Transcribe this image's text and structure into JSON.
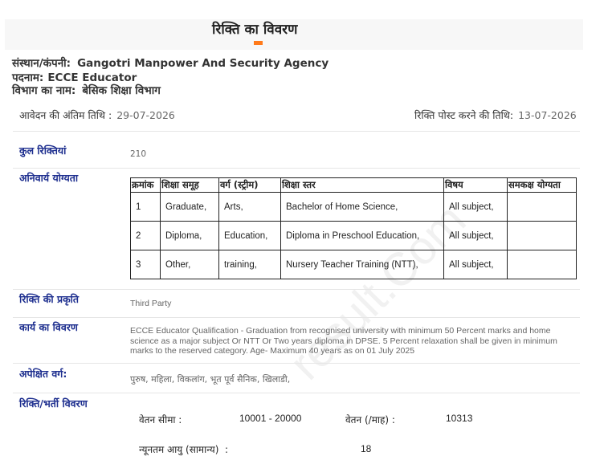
{
  "title": "रिक्ति का विवरण",
  "org": {
    "institution_label": "संस्थान/कंपनी:",
    "institution": "Gangotri Manpower And Security Agency",
    "post_label": "पदनाम:",
    "post": "ECCE Educator",
    "dept_label": "विभाग का नाम:",
    "dept": "बेसिक शिक्षा विभाग"
  },
  "dates": {
    "last_date_label": "आवेदन की अंतिम तिथि :",
    "last_date": "29-07-2026",
    "post_date_label": "रिक्ति पोस्ट करने की तिथि:",
    "post_date": "13-07-2026"
  },
  "vacancies": {
    "label": "कुल रिक्तियां",
    "value": "210"
  },
  "qualification": {
    "label": "अनिवार्य योग्यता",
    "headers": [
      "क्रमांक",
      "शिक्षा समूह",
      "वर्ग (स्ट्रीम)",
      "शिक्षा स्तर",
      "विषय",
      "समकक्ष योग्यता"
    ],
    "rows": [
      [
        "1",
        "Graduate,",
        "Arts,",
        "Bachelor of Home Science,",
        "All subject,",
        ""
      ],
      [
        "2",
        "Diploma,",
        "Education,",
        "Diploma in Preschool Education,",
        "All subject,",
        ""
      ],
      [
        "3",
        "Other,",
        "training,",
        "Nursery Teacher Training (NTT),",
        "All subject,",
        ""
      ]
    ]
  },
  "nature": {
    "label": "रिक्ति की प्रकृति",
    "value": "Third Party"
  },
  "work": {
    "label": "कार्य का विवरण",
    "value": "ECCE Educator Qualification - Graduation from recognised university with minimum 50 Percent marks and home science as a major subject Or NTT Or Two years diploma in DPSE. 5 Percent relaxation shall be given in minimum marks to the reserved category. Age- Maximum 40 years as on 01 July 2025"
  },
  "category": {
    "label": "अपेक्षित वर्ग:",
    "value": "पुरुष, महिला, विकलांग, भूत पूर्व सैनिक, खिलाडी,"
  },
  "recruitment": {
    "label": "रिक्ति/भर्ती विवरण",
    "pay_range_label": "वेतन सीमा :",
    "pay_range": "10001 - 20000",
    "salary_label": "वेतन (/माह) :",
    "salary": "10313",
    "min_age_label": "न्यूनतम आयु (सामान्य)  :",
    "min_age": "18"
  }
}
